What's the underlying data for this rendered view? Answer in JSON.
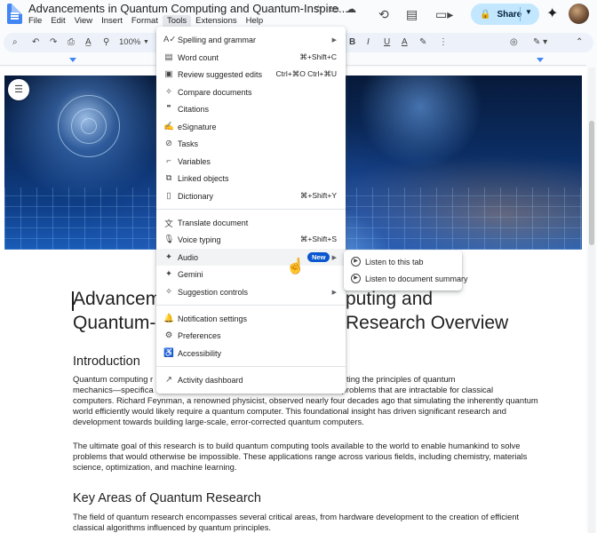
{
  "app": {
    "doc_title": "Advancements in Quantum Computing and Quantum-Inspire...",
    "menus": [
      "File",
      "Edit",
      "View",
      "Insert",
      "Format",
      "Tools",
      "Extensions",
      "Help"
    ],
    "active_menu": "Tools",
    "share_label": "Share",
    "zoom": "100%"
  },
  "tools_menu": {
    "items": [
      {
        "icon": "spellcheck-icon",
        "label": "Spelling and grammar",
        "shortcut": "",
        "submenu": true
      },
      {
        "icon": "word-count-icon",
        "label": "Word count",
        "shortcut": "⌘+Shift+C",
        "submenu": false
      },
      {
        "icon": "review-edits-icon",
        "label": "Review suggested edits",
        "shortcut": "Ctrl+⌘O Ctrl+⌘U",
        "submenu": false
      },
      {
        "icon": "compare-icon",
        "label": "Compare documents",
        "shortcut": "",
        "submenu": false
      },
      {
        "icon": "quote-icon",
        "label": "Citations",
        "shortcut": "",
        "submenu": false
      },
      {
        "icon": "signature-icon",
        "label": "eSignature",
        "shortcut": "",
        "submenu": false
      },
      {
        "icon": "task-icon",
        "label": "Tasks",
        "shortcut": "",
        "submenu": false
      },
      {
        "icon": "variables-icon",
        "label": "Variables",
        "shortcut": "",
        "submenu": false
      },
      {
        "icon": "linked-objects-icon",
        "label": "Linked objects",
        "shortcut": "",
        "submenu": false
      },
      {
        "icon": "dictionary-icon",
        "label": "Dictionary",
        "shortcut": "⌘+Shift+Y",
        "submenu": false
      },
      {
        "icon": "translate-icon",
        "label": "Translate document",
        "shortcut": "",
        "submenu": false
      },
      {
        "icon": "microphone-icon",
        "label": "Voice typing",
        "shortcut": "⌘+Shift+S",
        "submenu": false
      },
      {
        "icon": "audio-icon",
        "label": "Audio",
        "shortcut": "",
        "submenu": true,
        "badge": "New"
      },
      {
        "icon": "gemini-icon",
        "label": "Gemini",
        "shortcut": "",
        "submenu": false
      },
      {
        "icon": "suggestion-icon",
        "label": "Suggestion controls",
        "shortcut": "",
        "submenu": true
      },
      {
        "icon": "bell-icon",
        "label": "Notification settings",
        "shortcut": "",
        "submenu": false
      },
      {
        "icon": "preferences-icon",
        "label": "Preferences",
        "shortcut": "",
        "submenu": false
      },
      {
        "icon": "accessibility-icon",
        "label": "Accessibility",
        "shortcut": "",
        "submenu": false
      },
      {
        "icon": "activity-icon",
        "label": "Activity dashboard",
        "shortcut": "",
        "submenu": false
      }
    ]
  },
  "audio_submenu": {
    "items": [
      "Listen to this tab",
      "Listen to document summary"
    ]
  },
  "document": {
    "title_line1_left": "Advancem",
    "title_line1_right": "puting and",
    "title_line2_left": "Quantum-",
    "title_line2_right": "Research Overview",
    "intro_heading": "Introduction",
    "intro_para1_line1_left": "Quantum computing r",
    "intro_para1_line1_right": "ting the principles of quantum",
    "intro_para1_line2": "mechanics—specifica",
    "intro_para1_line2_right": "to solve certain problems that are intractable for classical",
    "intro_para1_rest": "computers. Richard Feynman, a renowned physicist, observed nearly four decades ago that simulating the inherently quantum world efficiently would likely require a quantum computer. This foundational insight has driven significant research and development towards building large-scale, error-corrected quantum computers.",
    "intro_para2": "The ultimate goal of this research is to build quantum computing tools available to the world to enable humankind to solve problems that would otherwise be impossible. These applications range across various fields, including chemistry, materials science, optimization, and machine learning.",
    "key_heading": "Key Areas of Quantum Research",
    "key_para": "The field of quantum research encompasses several critical areas, from hardware development to the creation of efficient classical algorithms influenced by quantum principles."
  }
}
